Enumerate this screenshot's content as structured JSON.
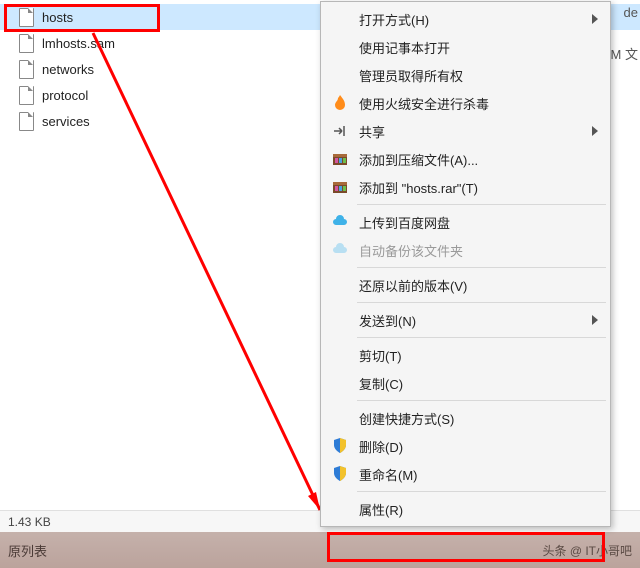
{
  "files": [
    {
      "name": "hosts",
      "selected": true
    },
    {
      "name": "lmhosts.sam",
      "selected": false
    },
    {
      "name": "networks",
      "selected": false
    },
    {
      "name": "protocol",
      "selected": false
    },
    {
      "name": "services",
      "selected": false
    }
  ],
  "date_fragments": {
    "de": "de",
    "am": "AM 文"
  },
  "status": {
    "size": "1.43 KB"
  },
  "bottom": {
    "label": "原列表",
    "watermark": "头条 @ IT小哥吧"
  },
  "menu": {
    "open_with": "打开方式(H)",
    "notepad_open": "使用记事本打开",
    "admin_take": "管理员取得所有权",
    "huorong": "使用火绒安全进行杀毒",
    "share": "共享",
    "archive_add": "添加到压缩文件(A)...",
    "archive_hosts": "添加到 \"hosts.rar\"(T)",
    "baidu_upload": "上传到百度网盘",
    "baidu_backup": "自动备份该文件夹",
    "restore_prev": "还原以前的版本(V)",
    "send_to": "发送到(N)",
    "cut": "剪切(T)",
    "copy": "复制(C)",
    "shortcut": "创建快捷方式(S)",
    "delete": "删除(D)",
    "rename": "重命名(M)",
    "properties": "属性(R)"
  },
  "colors": {
    "selection": "#cde8ff",
    "highlight": "#ff0000",
    "huorong": "#ff8c1a",
    "baidu": "#3fb2e8",
    "shield_blue": "#2e7cd6",
    "shield_yellow": "#f3c22b"
  }
}
